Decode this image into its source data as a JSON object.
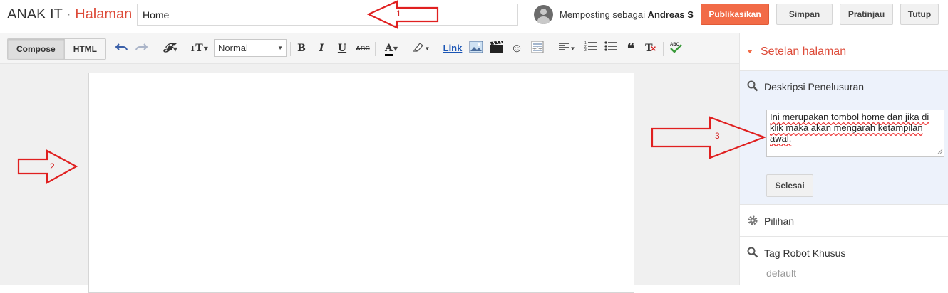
{
  "header": {
    "blog_name": "ANAK IT",
    "separator": "·",
    "section_name": "Halaman",
    "title_value": "Home",
    "posting_as_prefix": "Memposting sebagai ",
    "posting_as_user": "Andreas S",
    "publish_label": "Publikasikan",
    "save_label": "Simpan",
    "preview_label": "Pratinjau",
    "close_label": "Tutup"
  },
  "toolbar": {
    "compose_label": "Compose",
    "html_label": "HTML",
    "format_value": "Normal",
    "link_label": "Link"
  },
  "sidebar": {
    "settings_label": "Setelan halaman",
    "search_desc_label": "Deskripsi Penelusuran",
    "search_desc_value": "Ini merupakan tombol home dan jika di klik maka akan mengarah ketampilan awal.",
    "done_label": "Selesai",
    "options_label": "Pilihan",
    "robot_tags_label": "Tag Robot Khusus",
    "robot_tags_value": "default"
  },
  "annotations": {
    "arrow1_label": "1",
    "arrow2_label": "2",
    "arrow3_label": "3"
  },
  "colors": {
    "accent": "#f26b47",
    "section_title": "#dd4b39",
    "annotation": "#e02020"
  }
}
